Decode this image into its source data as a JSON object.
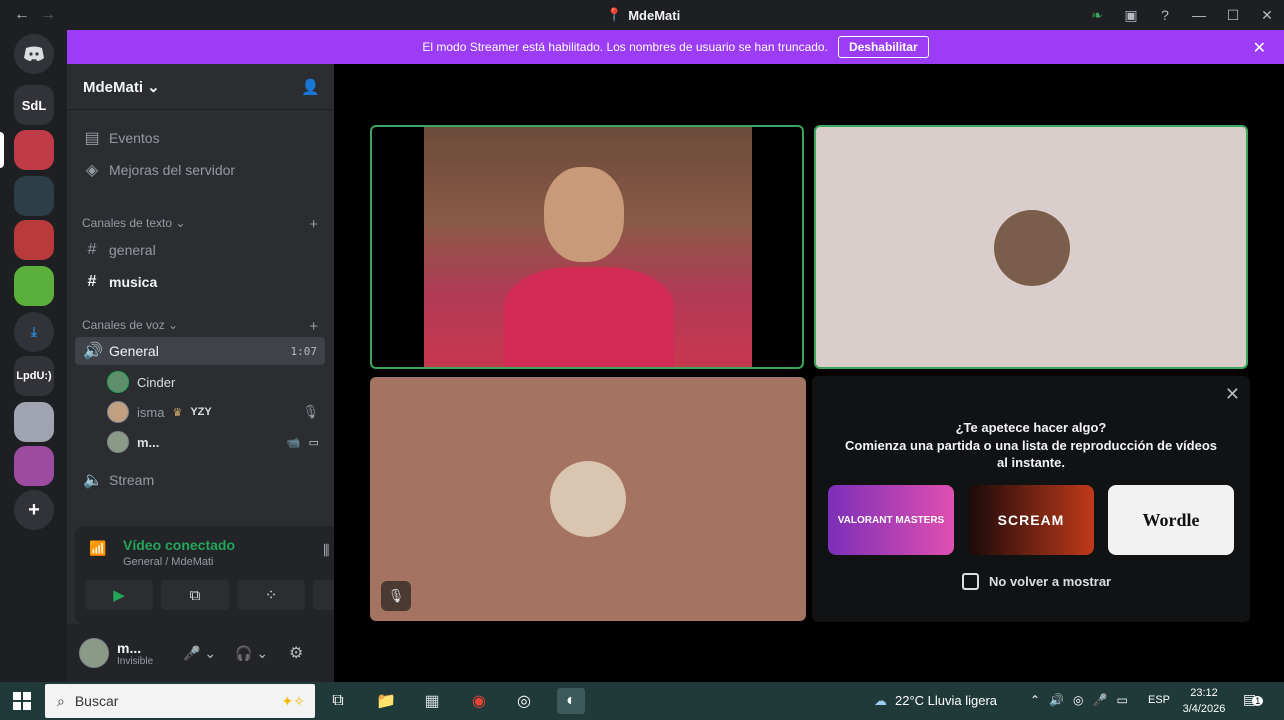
{
  "window": {
    "title": "MdeMati"
  },
  "banner": {
    "text": "El modo Streamer está habilitado. Los nombres de usuario se han truncado.",
    "button": "Deshabilitar"
  },
  "servers": [
    {
      "label": "SdL"
    },
    {
      "label": "LpdU:)"
    }
  ],
  "sidebar": {
    "server_name": "MdeMati",
    "events": "Eventos",
    "boosts": "Mejoras del servidor",
    "text_category": "Canales de texto",
    "text_channels": [
      {
        "name": "general"
      },
      {
        "name": "musica"
      }
    ],
    "voice_category": "Canales de voz",
    "voice_channel": {
      "name": "General",
      "timer": "1:07"
    },
    "voice_users": [
      {
        "name": "Cinder"
      },
      {
        "name": "isma",
        "tag": "YZY"
      },
      {
        "name": "m..."
      }
    ],
    "stream_channel": "Stream"
  },
  "voice_panel": {
    "status": "Vídeo conectado",
    "channel": "General / MdeMati"
  },
  "user_panel": {
    "name": "m...",
    "status": "Invisible"
  },
  "popup": {
    "title": "¿Te apetece hacer algo?",
    "subtitle": "Comienza una partida o una lista de reproducción de vídeos al instante.",
    "checkbox": "No volver a mostrar",
    "games": [
      {
        "label": "VALORANT MASTERS"
      },
      {
        "label": "SCREAM"
      },
      {
        "label": "Wordle"
      }
    ]
  },
  "taskbar": {
    "search": "Buscar",
    "weather": "22°C  Lluvia ligera",
    "lang": "ESP",
    "time": "23:12",
    "date": "3/4/2026",
    "notif": "1"
  },
  "colors": {
    "accent": "#9c3cf5",
    "connected": "#23a55a",
    "speaking": "#3ba55c"
  }
}
